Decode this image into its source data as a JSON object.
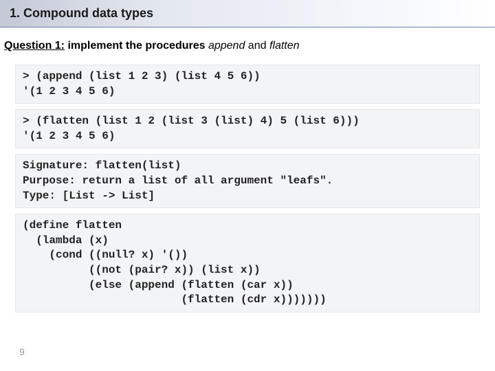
{
  "header": {
    "title": "1. Compound data types"
  },
  "question": {
    "label_underlined": "Question 1:",
    "text_1": " implement the procedures ",
    "proc1": "append",
    "text_2": " and ",
    "proc2": "flatten"
  },
  "code_blocks": [
    "> (append (list 1 2 3) (list 4 5 6))\n'(1 2 3 4 5 6)",
    "> (flatten (list 1 2 (list 3 (list) 4) 5 (list 6)))\n'(1 2 3 4 5 6)",
    "Signature: flatten(list)\nPurpose: return a list of all argument \"leafs\".\nType: [List -> List]",
    "(define flatten\n  (lambda (x)\n    (cond ((null? x) '())\n          ((not (pair? x)) (list x))\n          (else (append (flatten (car x))\n                        (flatten (cdr x)))))))"
  ],
  "page_number": "9"
}
